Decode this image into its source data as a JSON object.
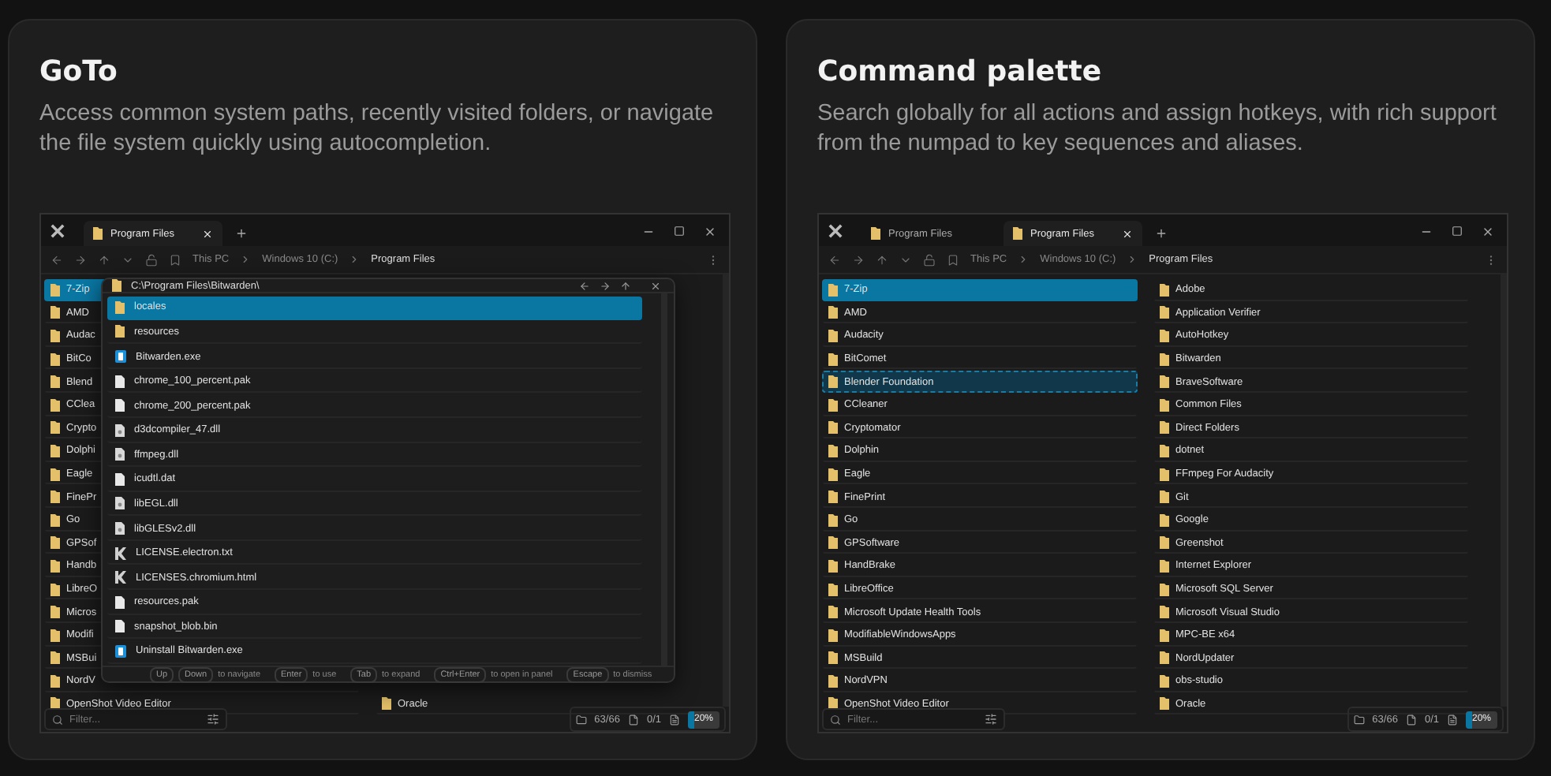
{
  "cards": [
    {
      "title": "GoTo",
      "description": "Access common system paths, recently visited folders, or navigate the file system quickly using autocompletion.",
      "window": {
        "tabs": [
          {
            "label": "Program Files",
            "selected": true
          }
        ],
        "breadcrumbs": [
          "This PC",
          "Windows 10 (C:)",
          "Program Files"
        ],
        "columns": [
          {
            "items": [
              {
                "name": "7-Zip",
                "selected": true,
                "focused": false
              },
              {
                "name": "AMD",
                "selected": false,
                "focused": false
              },
              {
                "name": "Audac",
                "selected": false,
                "focused": false
              },
              {
                "name": "BitCo",
                "selected": false,
                "focused": false
              },
              {
                "name": "Blend",
                "selected": false,
                "focused": false
              },
              {
                "name": "CClea",
                "selected": false,
                "focused": false
              },
              {
                "name": "Crypto",
                "selected": false,
                "focused": false
              },
              {
                "name": "Dolphi",
                "selected": false,
                "focused": false
              },
              {
                "name": "Eagle",
                "selected": false,
                "focused": false
              },
              {
                "name": "FinePr",
                "selected": false,
                "focused": false
              },
              {
                "name": "Go",
                "selected": false,
                "focused": false
              },
              {
                "name": "GPSof",
                "selected": false,
                "focused": false
              },
              {
                "name": "Handb",
                "selected": false,
                "focused": false
              },
              {
                "name": "LibreO",
                "selected": false,
                "focused": false
              },
              {
                "name": "Micros",
                "selected": false,
                "focused": false
              },
              {
                "name": "Modifi",
                "selected": false,
                "focused": false
              },
              {
                "name": "MSBui",
                "selected": false,
                "focused": false
              },
              {
                "name": "NordV",
                "selected": false,
                "focused": false
              },
              {
                "name": "OpenShot Video Editor",
                "selected": false,
                "focused": false
              }
            ]
          },
          {
            "items": [
              {
                "name": "Oracle",
                "selected": false,
                "focused": false
              }
            ]
          }
        ],
        "popup": {
          "path": "C:\\Program Files\\Bitwarden\\",
          "items": [
            {
              "name": "locales",
              "kind": "folder",
              "selected": true
            },
            {
              "name": "resources",
              "kind": "folder",
              "selected": false
            },
            {
              "name": "Bitwarden.exe",
              "kind": "exe",
              "selected": false
            },
            {
              "name": "chrome_100_percent.pak",
              "kind": "file",
              "selected": false
            },
            {
              "name": "chrome_200_percent.pak",
              "kind": "file",
              "selected": false
            },
            {
              "name": "d3dcompiler_47.dll",
              "kind": "dll",
              "selected": false
            },
            {
              "name": "ffmpeg.dll",
              "kind": "dll",
              "selected": false
            },
            {
              "name": "icudtl.dat",
              "kind": "file",
              "selected": false
            },
            {
              "name": "libEGL.dll",
              "kind": "dll",
              "selected": false
            },
            {
              "name": "libGLESv2.dll",
              "kind": "dll",
              "selected": false
            },
            {
              "name": "LICENSE.electron.txt",
              "kind": "license",
              "selected": false
            },
            {
              "name": "LICENSES.chromium.html",
              "kind": "license",
              "selected": false
            },
            {
              "name": "resources.pak",
              "kind": "file",
              "selected": false
            },
            {
              "name": "snapshot_blob.bin",
              "kind": "file",
              "selected": false
            },
            {
              "name": "Uninstall Bitwarden.exe",
              "kind": "exe",
              "selected": false
            }
          ],
          "hints": [
            {
              "keys": [
                "Up",
                "Down"
              ],
              "text": "to navigate"
            },
            {
              "keys": [
                "Enter"
              ],
              "text": "to use"
            },
            {
              "keys": [
                "Tab"
              ],
              "text": "to expand"
            },
            {
              "keys": [
                "Ctrl+Enter"
              ],
              "text": "to open in panel"
            },
            {
              "keys": [
                "Escape"
              ],
              "text": "to dismiss"
            }
          ]
        },
        "filter": {
          "placeholder": "Filter..."
        },
        "status": {
          "folders": "63/66",
          "files": "0/1",
          "zoom": "20%",
          "level": 0.2
        }
      }
    },
    {
      "title": "Command palette",
      "description": "Search globally for all actions and assign hotkeys, with rich support from the numpad to key sequences and aliases.",
      "window": {
        "tabs": [
          {
            "label": "Program Files",
            "selected": false
          },
          {
            "label": "Program Files",
            "selected": true
          }
        ],
        "breadcrumbs": [
          "This PC",
          "Windows 10 (C:)",
          "Program Files"
        ],
        "columns": [
          {
            "items": [
              {
                "name": "7-Zip",
                "selected": true,
                "focused": false
              },
              {
                "name": "AMD",
                "selected": false,
                "focused": false
              },
              {
                "name": "Audacity",
                "selected": false,
                "focused": false
              },
              {
                "name": "BitComet",
                "selected": false,
                "focused": false
              },
              {
                "name": "Blender Foundation",
                "selected": false,
                "focused": true
              },
              {
                "name": "CCleaner",
                "selected": false,
                "focused": false
              },
              {
                "name": "Cryptomator",
                "selected": false,
                "focused": false
              },
              {
                "name": "Dolphin",
                "selected": false,
                "focused": false
              },
              {
                "name": "Eagle",
                "selected": false,
                "focused": false
              },
              {
                "name": "FinePrint",
                "selected": false,
                "focused": false
              },
              {
                "name": "Go",
                "selected": false,
                "focused": false
              },
              {
                "name": "GPSoftware",
                "selected": false,
                "focused": false
              },
              {
                "name": "HandBrake",
                "selected": false,
                "focused": false
              },
              {
                "name": "LibreOffice",
                "selected": false,
                "focused": false
              },
              {
                "name": "Microsoft Update Health Tools",
                "selected": false,
                "focused": false
              },
              {
                "name": "ModifiableWindowsApps",
                "selected": false,
                "focused": false
              },
              {
                "name": "MSBuild",
                "selected": false,
                "focused": false
              },
              {
                "name": "NordVPN",
                "selected": false,
                "focused": false
              },
              {
                "name": "OpenShot Video Editor",
                "selected": false,
                "focused": false
              }
            ]
          },
          {
            "items": [
              {
                "name": "Adobe",
                "selected": false,
                "focused": false
              },
              {
                "name": "Application Verifier",
                "selected": false,
                "focused": false
              },
              {
                "name": "AutoHotkey",
                "selected": false,
                "focused": false
              },
              {
                "name": "Bitwarden",
                "selected": false,
                "focused": false
              },
              {
                "name": "BraveSoftware",
                "selected": false,
                "focused": false
              },
              {
                "name": "Common Files",
                "selected": false,
                "focused": false
              },
              {
                "name": "Direct Folders",
                "selected": false,
                "focused": false
              },
              {
                "name": "dotnet",
                "selected": false,
                "focused": false
              },
              {
                "name": "FFmpeg For Audacity",
                "selected": false,
                "focused": false
              },
              {
                "name": "Git",
                "selected": false,
                "focused": false
              },
              {
                "name": "Google",
                "selected": false,
                "focused": false
              },
              {
                "name": "Greenshot",
                "selected": false,
                "focused": false
              },
              {
                "name": "Internet Explorer",
                "selected": false,
                "focused": false
              },
              {
                "name": "Microsoft SQL Server",
                "selected": false,
                "focused": false
              },
              {
                "name": "Microsoft Visual Studio",
                "selected": false,
                "focused": false
              },
              {
                "name": "MPC-BE x64",
                "selected": false,
                "focused": false
              },
              {
                "name": "NordUpdater",
                "selected": false,
                "focused": false
              },
              {
                "name": "obs-studio",
                "selected": false,
                "focused": false
              },
              {
                "name": "Oracle",
                "selected": false,
                "focused": false
              }
            ]
          }
        ],
        "filter": {
          "placeholder": "Filter..."
        },
        "status": {
          "folders": "63/66",
          "files": "0/1",
          "zoom": "20%",
          "level": 0.2
        }
      }
    }
  ]
}
